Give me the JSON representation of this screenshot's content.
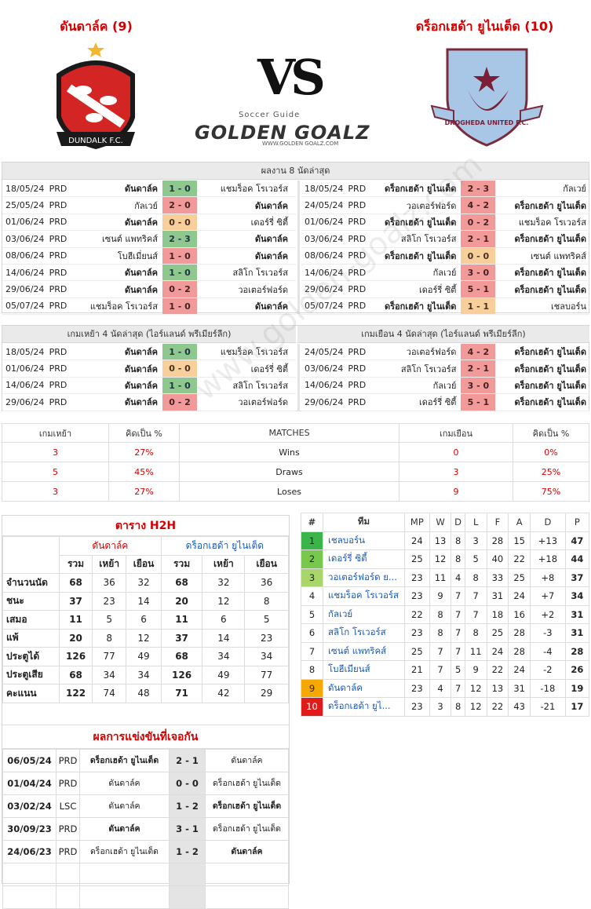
{
  "header": {
    "home_title": "ดันดาล์ค (9)",
    "away_title": "ดร็อกเฮด้า ยูไนเต็ด (10)",
    "vs": "VS",
    "brand_small": "Soccer Guide",
    "brand_big": "GOLDEN GOALZ",
    "brand_url": "WWW.GOLDEN GOALZ.COM",
    "home_crest_text": "DUNDALK F.C.",
    "away_crest_text": "DROGHEDA UNITED F.C."
  },
  "last8": {
    "title": "ผลงาน 8 นัดล่าสุด",
    "home": [
      {
        "date": "18/05/24",
        "comp": "PRD",
        "home": "ดันดาล์ค",
        "score": "1 - 0",
        "away": "แชมร็อค โรเวอร์ส",
        "res": "win",
        "hb": true,
        "ab": false
      },
      {
        "date": "25/05/24",
        "comp": "PRD",
        "home": "กัลเวย์",
        "score": "2 - 0",
        "away": "ดันดาล์ค",
        "res": "loss",
        "hb": false,
        "ab": true
      },
      {
        "date": "01/06/24",
        "comp": "PRD",
        "home": "ดันดาล์ค",
        "score": "0 - 0",
        "away": "เดอร์รี่ ซิตี้",
        "res": "draw",
        "hb": true,
        "ab": false
      },
      {
        "date": "03/06/24",
        "comp": "PRD",
        "home": "เซนต์ แพทริคส์",
        "score": "2 - 3",
        "away": "ดันดาล์ค",
        "res": "win",
        "hb": false,
        "ab": true
      },
      {
        "date": "08/06/24",
        "comp": "PRD",
        "home": "โบฮีเมี่ยนส์",
        "score": "1 - 0",
        "away": "ดันดาล์ค",
        "res": "loss",
        "hb": false,
        "ab": true
      },
      {
        "date": "14/06/24",
        "comp": "PRD",
        "home": "ดันดาล์ค",
        "score": "1 - 0",
        "away": "สลิโก โรเวอร์ส",
        "res": "win",
        "hb": true,
        "ab": false
      },
      {
        "date": "29/06/24",
        "comp": "PRD",
        "home": "ดันดาล์ค",
        "score": "0 - 2",
        "away": "วอเตอร์ฟอร์ด",
        "res": "loss",
        "hb": true,
        "ab": false
      },
      {
        "date": "05/07/24",
        "comp": "PRD",
        "home": "แชมร็อค โรเวอร์ส",
        "score": "1 - 0",
        "away": "ดันดาล์ค",
        "res": "loss",
        "hb": false,
        "ab": true
      }
    ],
    "away": [
      {
        "date": "18/05/24",
        "comp": "PRD",
        "home": "ดร็อกเฮด้า ยูไนเต็ด",
        "score": "2 - 3",
        "away": "กัลเวย์",
        "res": "loss",
        "hb": true,
        "ab": false
      },
      {
        "date": "24/05/24",
        "comp": "PRD",
        "home": "วอเตอร์ฟอร์ด",
        "score": "4 - 2",
        "away": "ดร็อกเฮด้า ยูไนเต็ด",
        "res": "loss",
        "hb": false,
        "ab": true
      },
      {
        "date": "01/06/24",
        "comp": "PRD",
        "home": "ดร็อกเฮด้า ยูไนเต็ด",
        "score": "0 - 2",
        "away": "แชมร็อค โรเวอร์ส",
        "res": "loss",
        "hb": true,
        "ab": false
      },
      {
        "date": "03/06/24",
        "comp": "PRD",
        "home": "สลิโก โรเวอร์ส",
        "score": "2 - 1",
        "away": "ดร็อกเฮด้า ยูไนเต็ด",
        "res": "loss",
        "hb": false,
        "ab": true
      },
      {
        "date": "08/06/24",
        "comp": "PRD",
        "home": "ดร็อกเฮด้า ยูไนเต็ด",
        "score": "0 - 0",
        "away": "เซนต์ แพทริคส์",
        "res": "draw",
        "hb": true,
        "ab": false
      },
      {
        "date": "14/06/24",
        "comp": "PRD",
        "home": "กัลเวย์",
        "score": "3 - 0",
        "away": "ดร็อกเฮด้า ยูไนเต็ด",
        "res": "loss",
        "hb": false,
        "ab": true
      },
      {
        "date": "29/06/24",
        "comp": "PRD",
        "home": "เดอร์รี่ ซิตี้",
        "score": "5 - 1",
        "away": "ดร็อกเฮด้า ยูไนเต็ด",
        "res": "loss",
        "hb": false,
        "ab": true
      },
      {
        "date": "05/07/24",
        "comp": "PRD",
        "home": "ดร็อกเฮด้า ยูไนเต็ด",
        "score": "1 - 1",
        "away": "เชลบอร์น",
        "res": "draw",
        "hb": true,
        "ab": false
      }
    ]
  },
  "last4": {
    "home_title": "เกมเหย้า 4 นัดล่าสุด (ไอร์แลนด์ พรีเมียร์ลีก)",
    "away_title": "เกมเยือน 4 นัดล่าสุด (ไอร์แลนด์ พรีเมียร์ลีก)",
    "home": [
      {
        "date": "18/05/24",
        "comp": "PRD",
        "home": "ดันดาล์ค",
        "score": "1 - 0",
        "away": "แชมร็อค โรเวอร์ส",
        "res": "win",
        "hb": true,
        "ab": false
      },
      {
        "date": "01/06/24",
        "comp": "PRD",
        "home": "ดันดาล์ค",
        "score": "0 - 0",
        "away": "เดอร์รี่ ซิตี้",
        "res": "draw",
        "hb": true,
        "ab": false
      },
      {
        "date": "14/06/24",
        "comp": "PRD",
        "home": "ดันดาล์ค",
        "score": "1 - 0",
        "away": "สลิโก โรเวอร์ส",
        "res": "win",
        "hb": true,
        "ab": false
      },
      {
        "date": "29/06/24",
        "comp": "PRD",
        "home": "ดันดาล์ค",
        "score": "0 - 2",
        "away": "วอเตอร์ฟอร์ด",
        "res": "loss",
        "hb": true,
        "ab": false
      }
    ],
    "away": [
      {
        "date": "24/05/24",
        "comp": "PRD",
        "home": "วอเตอร์ฟอร์ด",
        "score": "4 - 2",
        "away": "ดร็อกเฮด้า ยูไนเต็ด",
        "res": "loss",
        "hb": false,
        "ab": true
      },
      {
        "date": "03/06/24",
        "comp": "PRD",
        "home": "สลิโก โรเวอร์ส",
        "score": "2 - 1",
        "away": "ดร็อกเฮด้า ยูไนเต็ด",
        "res": "loss",
        "hb": false,
        "ab": true
      },
      {
        "date": "14/06/24",
        "comp": "PRD",
        "home": "กัลเวย์",
        "score": "3 - 0",
        "away": "ดร็อกเฮด้า ยูไนเต็ด",
        "res": "loss",
        "hb": false,
        "ab": true
      },
      {
        "date": "29/06/24",
        "comp": "PRD",
        "home": "เดอร์รี่ ซิตี้",
        "score": "5 - 1",
        "away": "ดร็อกเฮด้า ยูไนเต็ด",
        "res": "loss",
        "hb": false,
        "ab": true
      }
    ]
  },
  "matches_summary": {
    "headers": [
      "เกมเหย้า",
      "คิดเป็น  %",
      "MATCHES",
      "เกมเยือน",
      "คิดเป็น  %"
    ],
    "rows": [
      {
        "home": "3",
        "home_pct": "27%",
        "label": "Wins",
        "away": "0",
        "away_pct": "0%"
      },
      {
        "home": "5",
        "home_pct": "45%",
        "label": "Draws",
        "away": "3",
        "away_pct": "25%"
      },
      {
        "home": "3",
        "home_pct": "27%",
        "label": "Loses",
        "away": "9",
        "away_pct": "75%"
      }
    ]
  },
  "h2h_table": {
    "title": "ตาราง H2H",
    "home_team": "ดันดาล์ค",
    "away_team": "ดร็อกเฮด้า ยูไนเต็ด",
    "sub": [
      "รวม",
      "เหย้า",
      "เยือน",
      "รวม",
      "เหย้า",
      "เยือน"
    ],
    "rows": [
      {
        "label": "จำนวนนัด",
        "vals": [
          "68",
          "36",
          "32",
          "68",
          "32",
          "36"
        ]
      },
      {
        "label": "ชนะ",
        "vals": [
          "37",
          "23",
          "14",
          "20",
          "12",
          "8"
        ]
      },
      {
        "label": "เสมอ",
        "vals": [
          "11",
          "5",
          "6",
          "11",
          "6",
          "5"
        ]
      },
      {
        "label": "แพ้",
        "vals": [
          "20",
          "8",
          "12",
          "37",
          "14",
          "23"
        ]
      },
      {
        "label": "ประตูได้",
        "vals": [
          "126",
          "77",
          "49",
          "68",
          "34",
          "34"
        ]
      },
      {
        "label": "ประตูเสีย",
        "vals": [
          "68",
          "34",
          "34",
          "126",
          "49",
          "77"
        ]
      },
      {
        "label": "คะแนน",
        "vals": [
          "122",
          "74",
          "48",
          "71",
          "42",
          "29"
        ]
      }
    ]
  },
  "h2h_results": {
    "title": "ผลการแข่งขันที่เจอกัน",
    "rows": [
      {
        "date": "06/05/24",
        "comp": "PRD",
        "home": "ดร็อกเฮด้า ยูไนเต็ด",
        "score": "2 - 1",
        "away": "ดันดาล์ค",
        "hb": true,
        "ab": false
      },
      {
        "date": "01/04/24",
        "comp": "PRD",
        "home": "ดันดาล์ค",
        "score": "0 - 0",
        "away": "ดร็อกเฮด้า ยูไนเต็ด",
        "hb": false,
        "ab": false
      },
      {
        "date": "03/02/24",
        "comp": "LSC",
        "home": "ดันดาล์ค",
        "score": "1 - 2",
        "away": "ดร็อกเฮด้า ยูไนเต็ด",
        "hb": false,
        "ab": true
      },
      {
        "date": "30/09/23",
        "comp": "PRD",
        "home": "ดันดาล์ค",
        "score": "3 - 1",
        "away": "ดร็อกเฮด้า ยูไนเต็ด",
        "hb": true,
        "ab": false
      },
      {
        "date": "24/06/23",
        "comp": "PRD",
        "home": "ดร็อกเฮด้า ยูไนเต็ด",
        "score": "1 - 2",
        "away": "ดันดาล์ค",
        "hb": false,
        "ab": true
      }
    ]
  },
  "standings": {
    "headers": [
      "#",
      "ทีม",
      "MP",
      "W",
      "D",
      "L",
      "F",
      "A",
      "D",
      "P"
    ],
    "rows": [
      {
        "pos": "1",
        "team": "เชลบอร์น",
        "mp": "24",
        "w": "13",
        "d": "8",
        "l": "3",
        "f": "28",
        "a": "15",
        "gd": "+13",
        "p": "47",
        "color": "#3bb54a"
      },
      {
        "pos": "2",
        "team": "เดอร์รี่ ซิตี้",
        "mp": "25",
        "w": "12",
        "d": "8",
        "l": "5",
        "f": "40",
        "a": "22",
        "gd": "+18",
        "p": "44",
        "color": "#79c84e"
      },
      {
        "pos": "3",
        "team": "วอเตอร์ฟอร์ด ย...",
        "mp": "23",
        "w": "11",
        "d": "4",
        "l": "8",
        "f": "33",
        "a": "25",
        "gd": "+8",
        "p": "37",
        "color": "#a8d66a"
      },
      {
        "pos": "4",
        "team": "แชมร็อค โรเวอร์ส",
        "mp": "23",
        "w": "9",
        "d": "7",
        "l": "7",
        "f": "31",
        "a": "24",
        "gd": "+7",
        "p": "34",
        "color": ""
      },
      {
        "pos": "5",
        "team": "กัลเวย์",
        "mp": "22",
        "w": "8",
        "d": "7",
        "l": "7",
        "f": "18",
        "a": "16",
        "gd": "+2",
        "p": "31",
        "color": ""
      },
      {
        "pos": "6",
        "team": "สลิโก โรเวอร์ส",
        "mp": "23",
        "w": "8",
        "d": "7",
        "l": "8",
        "f": "25",
        "a": "28",
        "gd": "-3",
        "p": "31",
        "color": ""
      },
      {
        "pos": "7",
        "team": "เซนต์ แพทริคส์",
        "mp": "25",
        "w": "7",
        "d": "7",
        "l": "11",
        "f": "24",
        "a": "28",
        "gd": "-4",
        "p": "28",
        "color": ""
      },
      {
        "pos": "8",
        "team": "โบฮีเมียนส์",
        "mp": "21",
        "w": "7",
        "d": "5",
        "l": "9",
        "f": "22",
        "a": "24",
        "gd": "-2",
        "p": "26",
        "color": ""
      },
      {
        "pos": "9",
        "team": "ดันดาล์ค",
        "mp": "23",
        "w": "4",
        "d": "7",
        "l": "12",
        "f": "13",
        "a": "31",
        "gd": "-18",
        "p": "19",
        "color": "#f5a800"
      },
      {
        "pos": "10",
        "team": "ดร็อกเฮด้า ยูไ...",
        "mp": "23",
        "w": "3",
        "d": "8",
        "l": "12",
        "f": "22",
        "a": "43",
        "gd": "-21",
        "p": "17",
        "color": "#e01b1b"
      }
    ]
  },
  "watermark": "www.golden-goalz.com"
}
